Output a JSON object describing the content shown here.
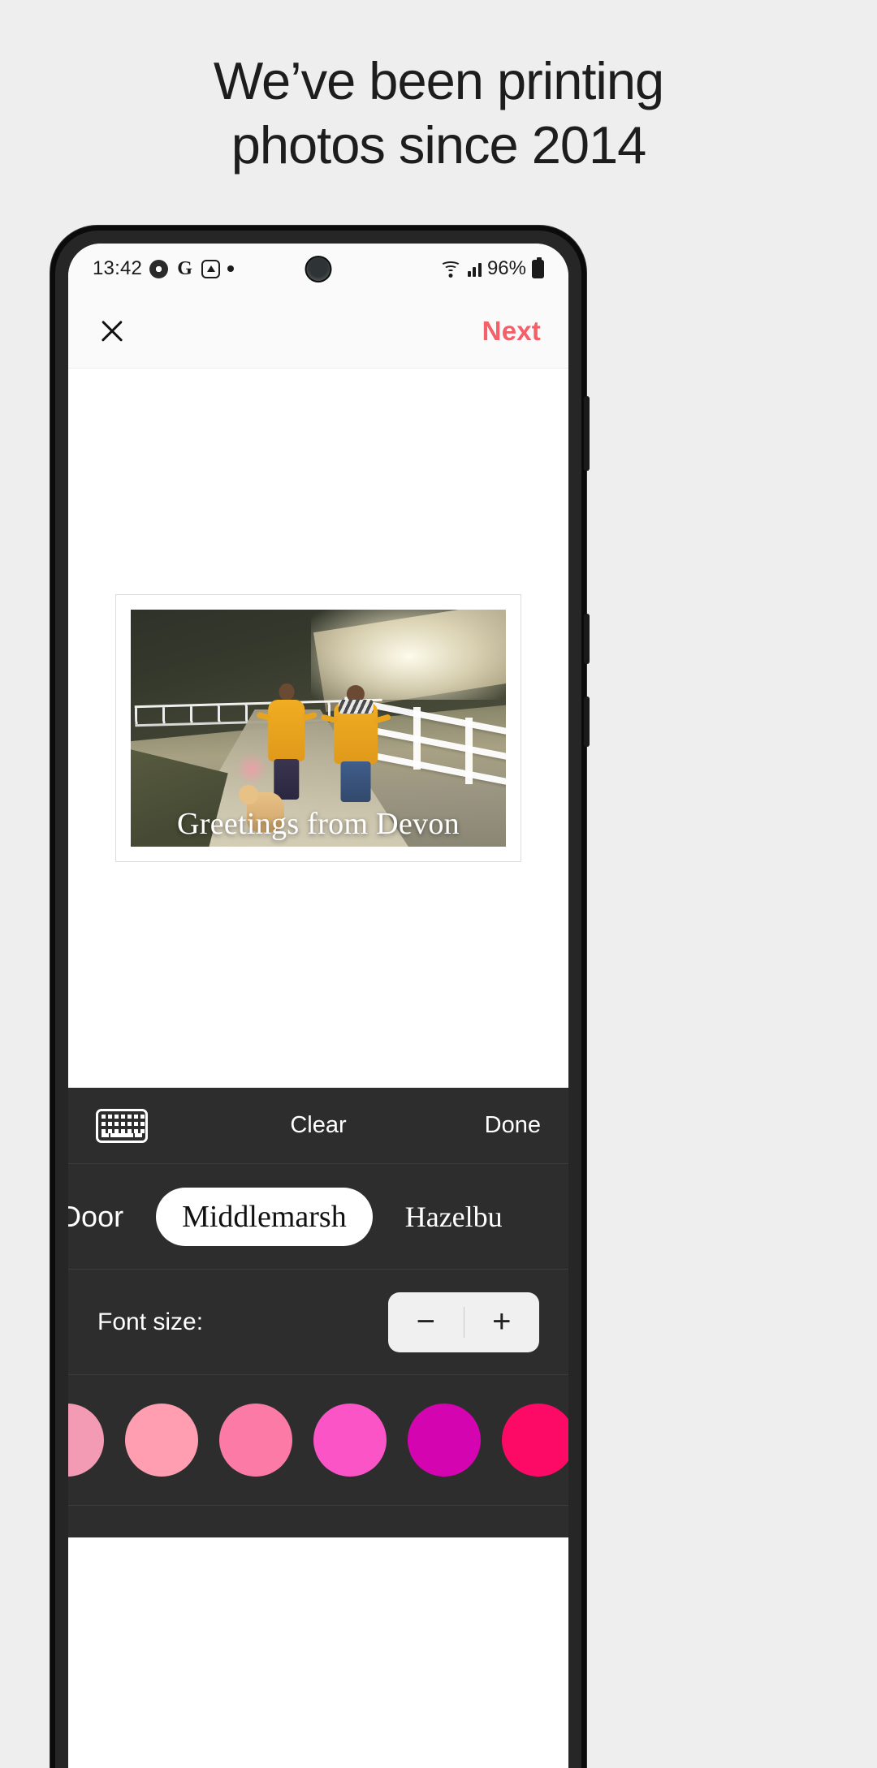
{
  "headline": {
    "line1": "We’ve been printing",
    "line2": "photos since 2014"
  },
  "phone": {
    "status_bar": {
      "time": "13:42",
      "icons": [
        "chrome-icon",
        "google-icon",
        "triangle-alert-icon",
        "dot-icon"
      ],
      "wifi": "wifi-icon",
      "signal": "cellular-signal-icon",
      "battery_percent": "96%",
      "battery": "battery-icon"
    },
    "app_bar": {
      "close_label": "close-icon",
      "next_label": "Next",
      "next_color": "#f4606a"
    },
    "canvas": {
      "postcard_caption": "Greetings from Devon"
    },
    "toolbar": {
      "keyboard_icon": "keyboard-icon",
      "clear_label": "Clear",
      "done_label": "Done"
    },
    "font_picker": {
      "items": [
        {
          "label": "dle Door",
          "selected": false
        },
        {
          "label": "Middlemarsh",
          "selected": true
        },
        {
          "label": "Hazelbu",
          "selected": false
        }
      ]
    },
    "font_size": {
      "label": "Font size:",
      "decrease_label": "−",
      "increase_label": "+"
    },
    "colors": {
      "swatches": [
        "#f39ab4",
        "#ff9eb0",
        "#fb7aa6",
        "#fb54c6",
        "#d405b0",
        "#fc0a66",
        "#e0338f"
      ]
    }
  }
}
